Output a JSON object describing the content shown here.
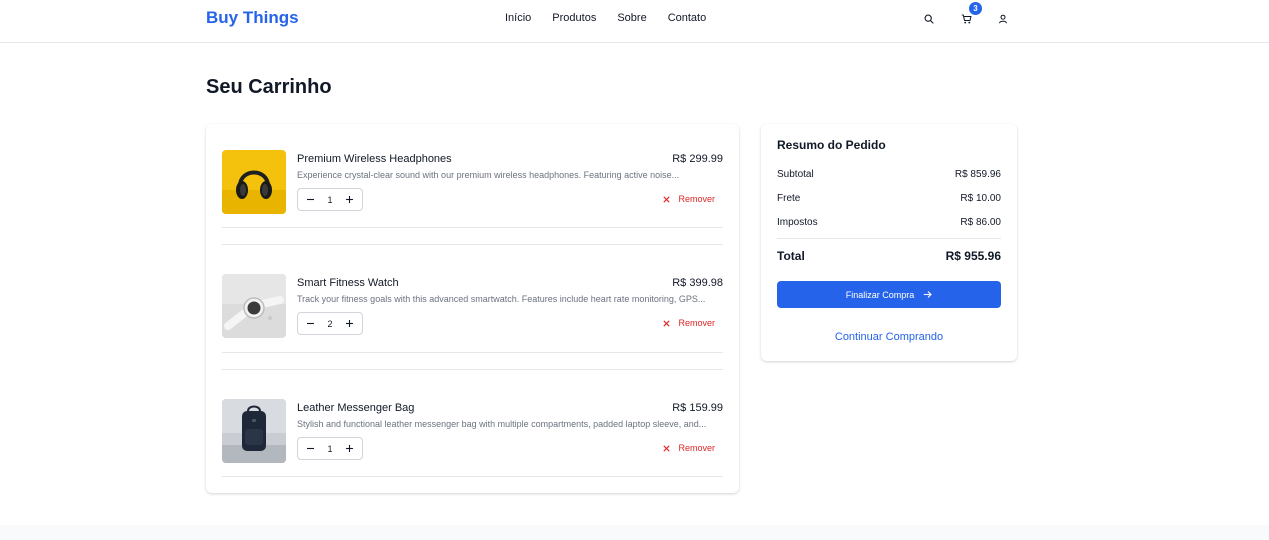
{
  "header": {
    "brand": "Buy Things",
    "nav": [
      "Início",
      "Produtos",
      "Sobre",
      "Contato"
    ],
    "cart_count": "3",
    "icons": [
      "search-icon",
      "cart-icon",
      "user-icon"
    ]
  },
  "page": {
    "title": "Seu Carrinho"
  },
  "cart": {
    "items": [
      {
        "name": "Premium Wireless Headphones",
        "price": "R$ 299.99",
        "description": "Experience crystal-clear sound with our premium wireless headphones. Featuring active noise...",
        "quantity": "1",
        "remove_label": "Remover"
      },
      {
        "name": "Smart Fitness Watch",
        "price": "R$ 399.98",
        "description": "Track your fitness goals with this advanced smartwatch. Features include heart rate monitoring, GPS...",
        "quantity": "2",
        "remove_label": "Remover"
      },
      {
        "name": "Leather Messenger Bag",
        "price": "R$ 159.99",
        "description": "Stylish and functional leather messenger bag with multiple compartments, padded laptop sleeve, and...",
        "quantity": "1",
        "remove_label": "Remover"
      }
    ]
  },
  "summary": {
    "title": "Resumo do Pedido",
    "subtotal_label": "Subtotal",
    "subtotal_value": "R$ 859.96",
    "shipping_label": "Frete",
    "shipping_value": "R$ 10.00",
    "taxes_label": "Impostos",
    "taxes_value": "R$ 86.00",
    "total_label": "Total",
    "total_value": "R$ 955.96",
    "checkout_label": "Finalizar Compra",
    "continue_label": "Continuar Comprando"
  },
  "colors": {
    "accent": "#2563eb",
    "danger": "#dc2626",
    "muted_text": "#6b7280",
    "border": "#e5e7eb"
  }
}
